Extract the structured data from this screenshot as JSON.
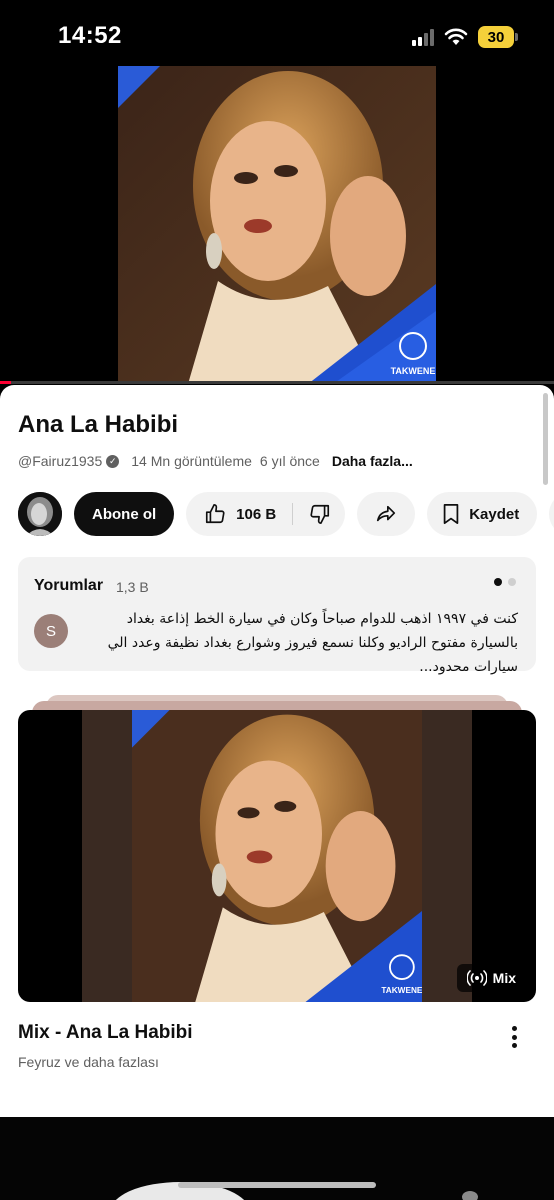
{
  "status_bar": {
    "time": "14:52",
    "battery": "30",
    "battery_color": "#f5d03a"
  },
  "player": {
    "channel_logo_text": "TAKWENE",
    "progress_fraction": 0.02,
    "accent": "#ff0033"
  },
  "video": {
    "title": "Ana La Habibi",
    "channel_handle": "@Fairuz1935",
    "views": "14 Mn görüntüleme",
    "age": "6 yıl önce",
    "more_label": "Daha fazla..."
  },
  "actions": {
    "subscribe_label": "Abone ol",
    "like_count": "106 B",
    "save_label": "Kaydet"
  },
  "comments": {
    "header": "Yorumlar",
    "count": "1,3 B",
    "first_comment": {
      "avatar_letter": "S",
      "text": "كنت في ١٩٩٧ اذهب للدوام صباحاً وكان في سيارة الخط إذاعة بغداد  بالسيارة مفتوح الراديو وكلنا نسمع فيروز وشوارع بغداد نظيفة وعدد الي سيارات محدود..."
    }
  },
  "mix": {
    "badge_label": "Mix",
    "logo_text": "TAKWENE",
    "title": "Mix - Ana La Habibi",
    "subtitle": "Feyruz ve daha fazlası"
  },
  "icons": [
    "signal-icon",
    "wifi-icon",
    "battery-icon",
    "verified-icon",
    "like-icon",
    "dislike-icon",
    "share-icon",
    "bookmark-icon",
    "radio-waves-icon",
    "more-vert-icon"
  ]
}
